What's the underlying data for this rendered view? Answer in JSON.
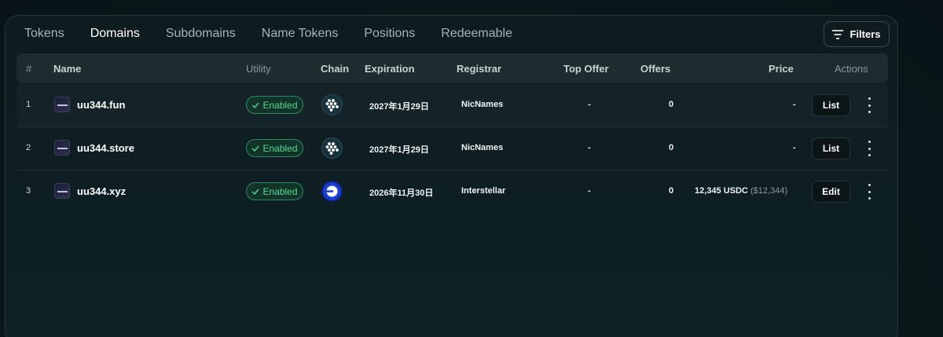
{
  "tabs": [
    "Tokens",
    "Domains",
    "Subdomains",
    "Name Tokens",
    "Positions",
    "Redeemable"
  ],
  "active_tab": "Domains",
  "filters_label": "Filters",
  "columns": {
    "index": "#",
    "name": "Name",
    "utility": "Utility",
    "chain": "Chain",
    "expiration": "Expiration",
    "registrar": "Registrar",
    "top_offer": "Top Offer",
    "offers": "Offers",
    "price": "Price",
    "actions": "Actions"
  },
  "rows": [
    {
      "index": "1",
      "name": "uu344.fun",
      "utility": "Enabled",
      "chain_icon": "dots-chain-icon",
      "expiration": "2027年1月29日",
      "registrar": "NicNames",
      "top_offer": "-",
      "offers": "0",
      "price": "-",
      "price_sub": "",
      "action": "List"
    },
    {
      "index": "2",
      "name": "uu344.store",
      "utility": "Enabled",
      "chain_icon": "dots-chain-icon",
      "expiration": "2027年1月29日",
      "registrar": "NicNames",
      "top_offer": "-",
      "offers": "0",
      "price": "-",
      "price_sub": "",
      "action": "List"
    },
    {
      "index": "3",
      "name": "uu344.xyz",
      "utility": "Enabled",
      "chain_icon": "base-chain-icon",
      "expiration": "2026年11月30日",
      "registrar": "Interstellar",
      "top_offer": "-",
      "offers": "0",
      "price": "12,345 USDC",
      "price_sub": "($12,344)",
      "action": "Edit"
    }
  ],
  "colors": {
    "enabled": "#52d69a",
    "accent_blue": "#1a3fd0"
  }
}
